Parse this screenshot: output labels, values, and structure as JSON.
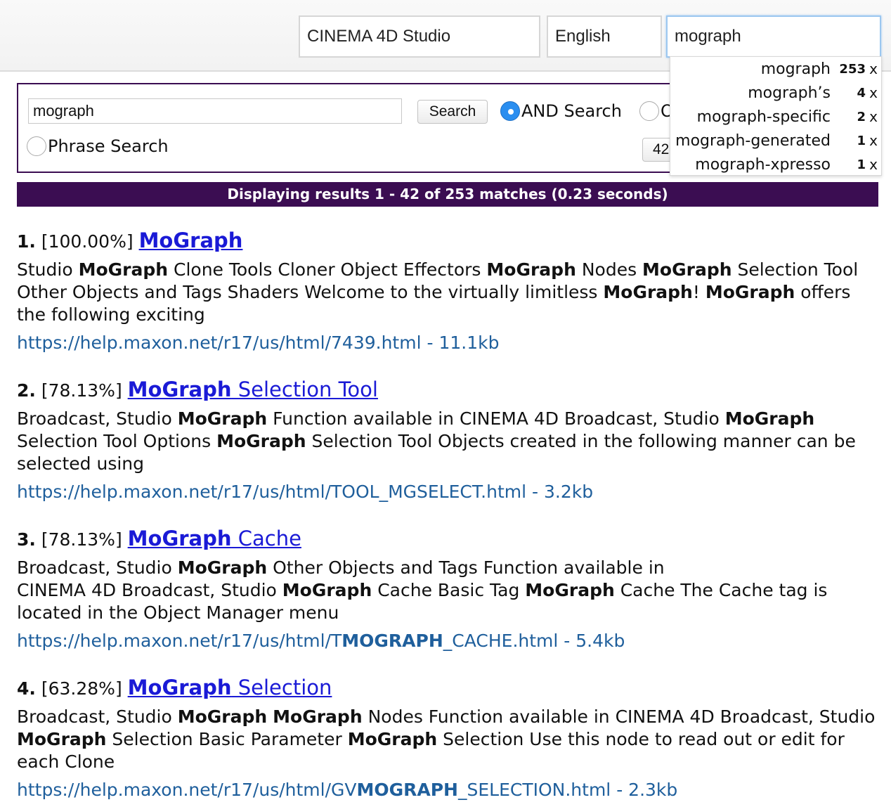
{
  "header": {
    "product": "CINEMA 4D Studio",
    "language": "English",
    "search_value": "mograph"
  },
  "autocomplete": [
    {
      "term": "mograph",
      "count": "253",
      "remove": "x"
    },
    {
      "term": "mograph’s",
      "count": "4",
      "remove": "x"
    },
    {
      "term": "mograph-specific",
      "count": "2",
      "remove": "x"
    },
    {
      "term": "mograph-generated",
      "count": "1",
      "remove": "x"
    },
    {
      "term": "mograph-xpresso",
      "count": "1",
      "remove": "x"
    }
  ],
  "form": {
    "query": "mograph",
    "search_button": "Search",
    "and_label": "AND Search",
    "or_label": "O",
    "phrase_label": "Phrase Search",
    "results_per_page": "42"
  },
  "status": "Displaying results 1 - 42 of 253 matches (0.23 seconds)",
  "results": [
    {
      "num": "1.",
      "score": "[100.00%]",
      "title_bold": "MoGraph",
      "title_rest": "",
      "snippet_html": "Studio <b>MoGraph</b> Clone Tools Cloner Object Effectors <b>MoGraph</b> Nodes <b>MoGraph</b> Selection Tool Other Objects and Tags Shaders Welcome to the virtually limitless <b>MoGraph</b>! <b>MoGraph</b> offers the following exciting",
      "url_html": "https://help.maxon.net/r17/us/html/7439.html - 11.1kb"
    },
    {
      "num": "2.",
      "score": "[78.13%]",
      "title_bold": "MoGraph",
      "title_rest": " Selection Tool",
      "snippet_html": "Broadcast, Studio <b>MoGraph</b> Function available in CINEMA 4D Broadcast, Studio <b>MoGraph</b> Selection Tool Options <b>MoGraph</b> Selection Tool Objects created in the following manner can be selected using",
      "url_html": "https://help.maxon.net/r17/us/html/TOOL_MGSELECT.html - 3.2kb"
    },
    {
      "num": "3.",
      "score": "[78.13%]",
      "title_bold": "MoGraph",
      "title_rest": " Cache",
      "snippet_html": "Broadcast, Studio <b>MoGraph</b> Other Objects and Tags Function available in<br>CINEMA 4D Broadcast, Studio <b>MoGraph</b> Cache Basic Tag <b>MoGraph</b> Cache The Cache tag is located in the Object Manager menu",
      "url_html": "https://help.maxon.net/r17/us/html/T<b>MOGRAPH</b>_CACHE.html - 5.4kb"
    },
    {
      "num": "4.",
      "score": "[63.28%]",
      "title_bold": "MoGraph",
      "title_rest": " Selection",
      "snippet_html": "Broadcast, Studio <b>MoGraph</b> <b>MoGraph</b> Nodes Function available in CINEMA 4D Broadcast, Studio <b>MoGraph</b> Selection Basic Parameter <b>MoGraph</b> Selection Use this node to read out or edit for each Clone",
      "url_html": "https://help.maxon.net/r17/us/html/GV<b>MOGRAPH</b>_SELECTION.html - 2.3kb"
    }
  ]
}
